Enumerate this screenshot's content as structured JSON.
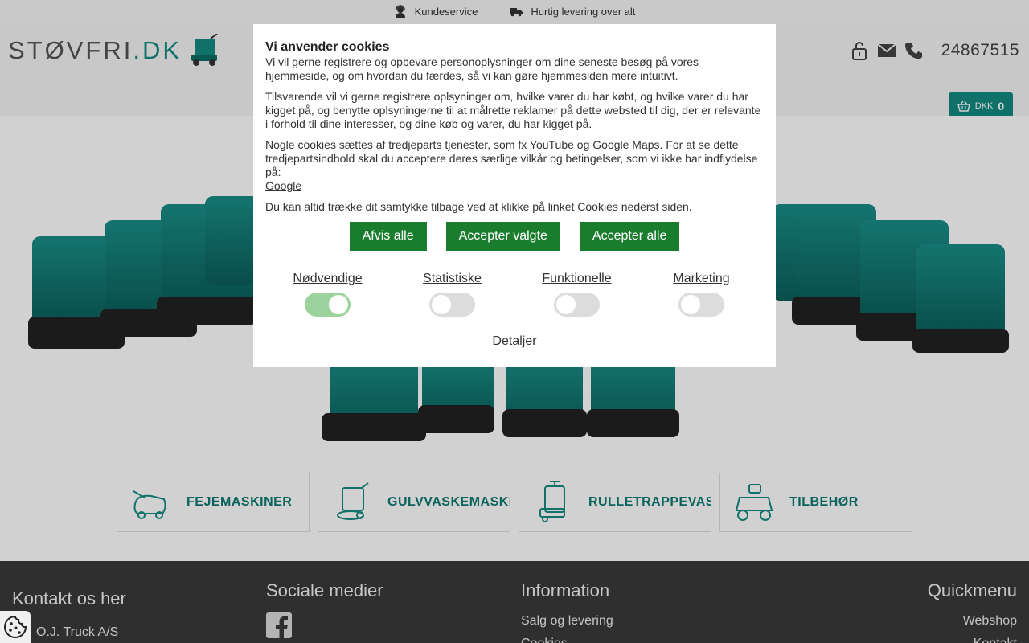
{
  "topbar": {
    "service": "Kundeservice",
    "delivery": "Hurtig levering over alt"
  },
  "header": {
    "logo_main": "STØVFRI",
    "logo_suffix": ".DK",
    "phone": "24867515"
  },
  "cart": {
    "currency": "DKK",
    "count": "0"
  },
  "categories": [
    {
      "label": "FEJEMASKINER",
      "icon": "sweeper-icon"
    },
    {
      "label": "GULVVASKEMASKINER",
      "icon": "scrubber-icon"
    },
    {
      "label": "RULLETRAPPEVASKER",
      "icon": "escalator-cleaner-icon"
    },
    {
      "label": "TILBEHØR",
      "icon": "ride-on-icon"
    }
  ],
  "footer": {
    "contact_title": "Kontakt os her",
    "contact_name": "O.J. Truck A/S",
    "social_title": "Sociale medier",
    "info_title": "Information",
    "info_link1": "Salg og levering",
    "info_link2": "Cookies",
    "quick_title": "Quickmenu",
    "quick_link1": "Webshop",
    "quick_link2": "Kontakt"
  },
  "cookie": {
    "title": "Vi anvender cookies",
    "p1": "Vi vil gerne registrere og opbevare personoplysninger om dine seneste besøg på vores hjemmeside, og om hvordan du færdes, så vi kan gøre hjemmesiden mere intuitivt.",
    "p2": "Tilsvarende vil vi gerne registrere oplsyninger om, hvilke varer du har købt, og hvilke varer du har kigget på, og benytte oplsyningerne til at målrette reklamer på dette websted til dig, der er relevante i forhold til dine interesser, og dine køb og varer, du har kigget på.",
    "p3": "Nogle cookies sættes af tredjeparts tjenester, som fx YouTube og Google Maps. For at se dette tredjepartsindhold skal du acceptere deres særlige vilkår og betingelser, som vi ikke har indflydelse på:",
    "google_link": "Google",
    "p4": "Du kan altid trække dit samtykke tilbage ved at klikke på linket Cookies nederst siden.",
    "btn_reject": "Afvis alle",
    "btn_selected": "Accepter valgte",
    "btn_all": "Accepter alle",
    "toggles": [
      {
        "label": "Nødvendige",
        "on": true
      },
      {
        "label": "Statistiske",
        "on": false
      },
      {
        "label": "Funktionelle",
        "on": false
      },
      {
        "label": "Marketing",
        "on": false
      }
    ],
    "details": "Detaljer"
  },
  "colors": {
    "brand": "#138a82",
    "button": "#1a7d2e",
    "footer": "#3a3a3a"
  }
}
